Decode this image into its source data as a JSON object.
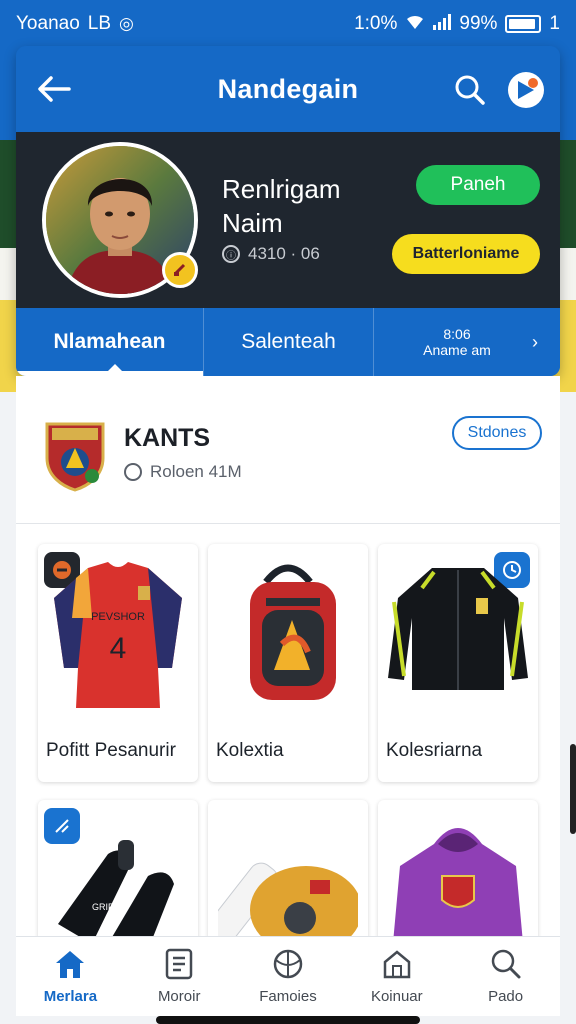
{
  "status_bar": {
    "left_text": "Yoanao",
    "left_extra": "LB",
    "right_text": "1:0%",
    "battery_text": "99%",
    "sim_text": "1"
  },
  "app_bar": {
    "title": "Nandegain"
  },
  "profile": {
    "name": "Renlrigam Naim",
    "meta": "4310 · 06",
    "follow_label": "Paneh",
    "membership_label": "Batterloniame"
  },
  "tabs": [
    {
      "label": "Nlamahean"
    },
    {
      "label": "Salenteah"
    },
    {
      "label_line1": "8:06",
      "label_line2": "Aname am"
    }
  ],
  "team": {
    "name": "KANTS",
    "location": "Roloen 41M",
    "stores_label": "Stdones"
  },
  "products": [
    {
      "name": "Pofitt Pesanurir",
      "icon": "jersey"
    },
    {
      "name": "Kolextia",
      "icon": "backpack"
    },
    {
      "name": "Kolesriarna",
      "icon": "jacket"
    },
    {
      "name": "",
      "icon": "gloves"
    },
    {
      "name": "",
      "icon": "accessories"
    },
    {
      "name": "",
      "icon": "hoodie"
    }
  ],
  "bottom_nav": [
    {
      "label": "Merlara",
      "icon": "home-icon",
      "active": true
    },
    {
      "label": "Moroir",
      "icon": "list-icon",
      "active": false
    },
    {
      "label": "Famoies",
      "icon": "ball-icon",
      "active": false
    },
    {
      "label": "Koinuar",
      "icon": "shop-icon",
      "active": false
    },
    {
      "label": "Pado",
      "icon": "search-icon",
      "active": false
    }
  ],
  "colors": {
    "primary": "#1569c6",
    "dark": "#1f262f",
    "follow": "#20c05a",
    "membership": "#f6dd1e"
  }
}
